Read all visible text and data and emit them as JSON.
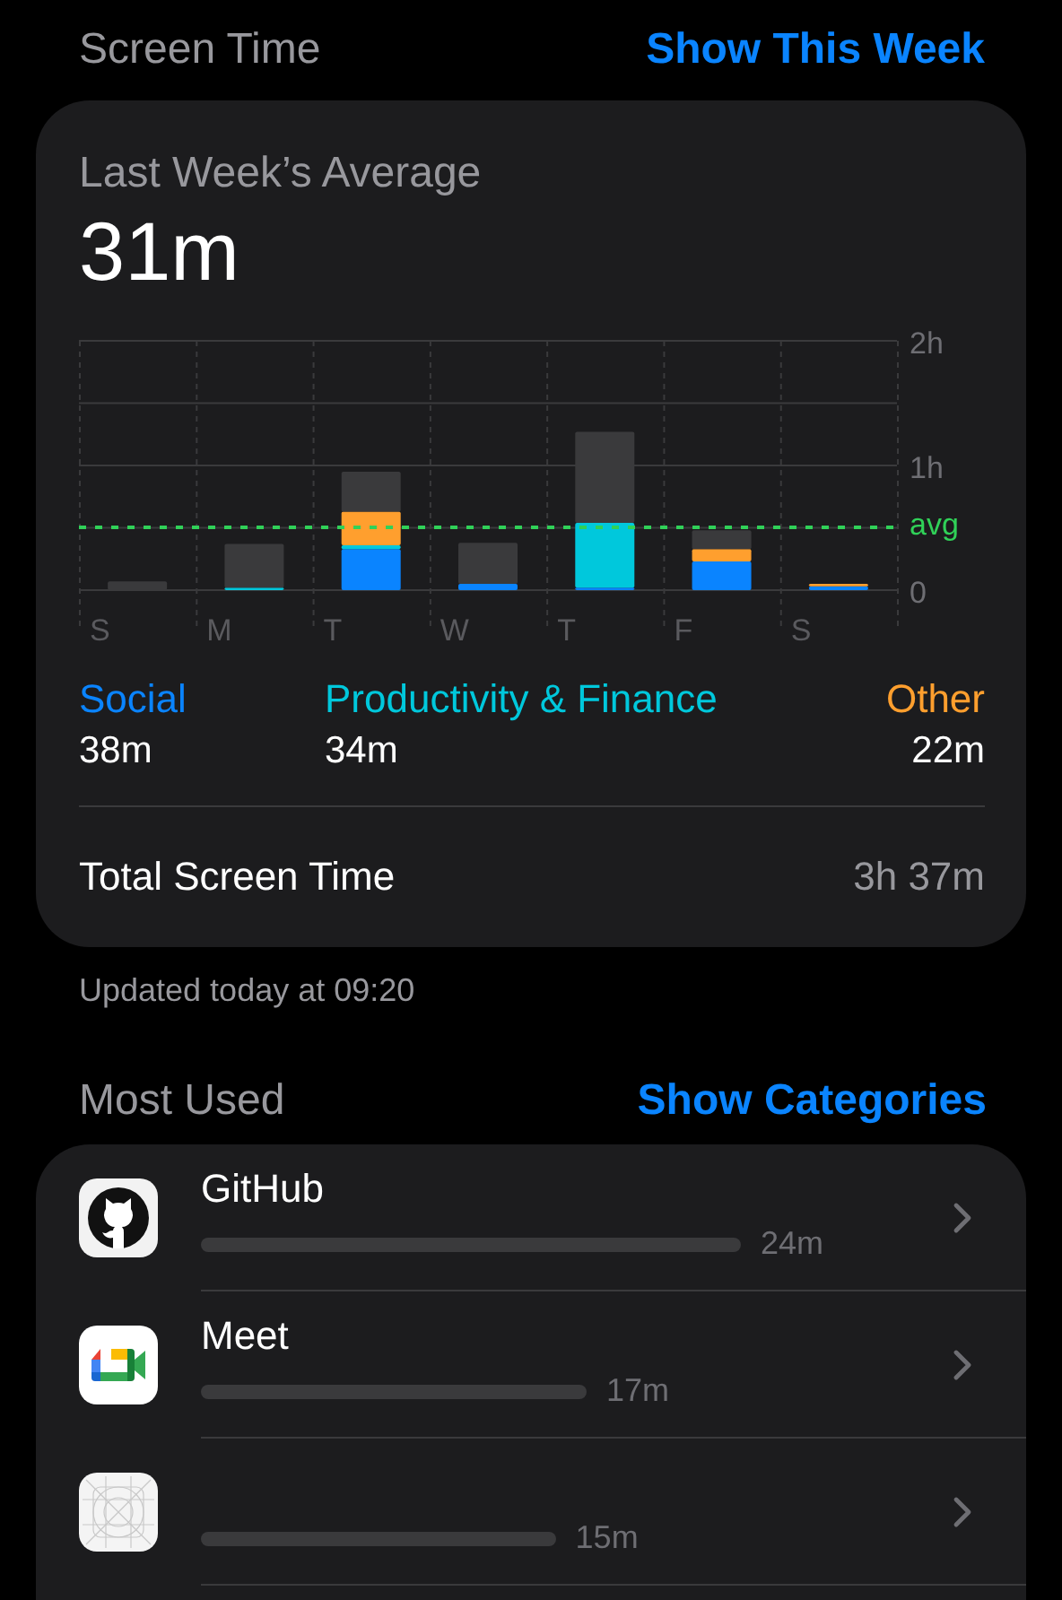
{
  "header": {
    "title": "Screen Time",
    "action": "Show This Week"
  },
  "summary": {
    "label": "Last Week’s Average",
    "value": "31m",
    "chart_data": {
      "type": "bar",
      "stacked": true,
      "categories": [
        "S",
        "M",
        "T",
        "W",
        "T",
        "F",
        "S"
      ],
      "ylim": [
        0,
        2
      ],
      "yticks": [
        {
          "value": 0,
          "label": "0"
        },
        {
          "value": 1,
          "label": "1h"
        },
        {
          "value": 2,
          "label": "2h"
        }
      ],
      "series": [
        {
          "name": "Social",
          "color": "#0a84ff",
          "values": [
            0,
            0,
            0.33,
            0.05,
            0.02,
            0.23,
            0.03
          ]
        },
        {
          "name": "Productivity & Finance",
          "color": "#00c8dc",
          "values": [
            0,
            0.02,
            0.03,
            0,
            0.52,
            0,
            0
          ]
        },
        {
          "name": "Other",
          "color": "#ff9f2e",
          "values": [
            0,
            0,
            0.27,
            0,
            0,
            0.1,
            0.02
          ]
        },
        {
          "color": "#3a3a3c",
          "values": [
            0.07,
            0.35,
            0.32,
            0.33,
            0.73,
            0.15,
            0
          ]
        }
      ]
    },
    "average_marker": "avg",
    "legend": [
      {
        "value": "38m"
      },
      {
        "value": "34m"
      },
      {
        "value": "22m"
      }
    ],
    "total": {
      "label": "Total Screen Time",
      "value": "3h 37m"
    }
  },
  "updated": "Updated today at 09:20",
  "most_used": {
    "title": "Most Used",
    "action": "Show Categories",
    "apps": [
      {
        "kind": "cat-logo",
        "name": "GitHub",
        "level": 0.7,
        "time": "24m"
      },
      {
        "kind": "camera-logo",
        "name": "Meet",
        "level": 0.5,
        "time": "17m"
      },
      {
        "kind": "placeholder",
        "level": 0.46,
        "time": "15m"
      }
    ]
  }
}
